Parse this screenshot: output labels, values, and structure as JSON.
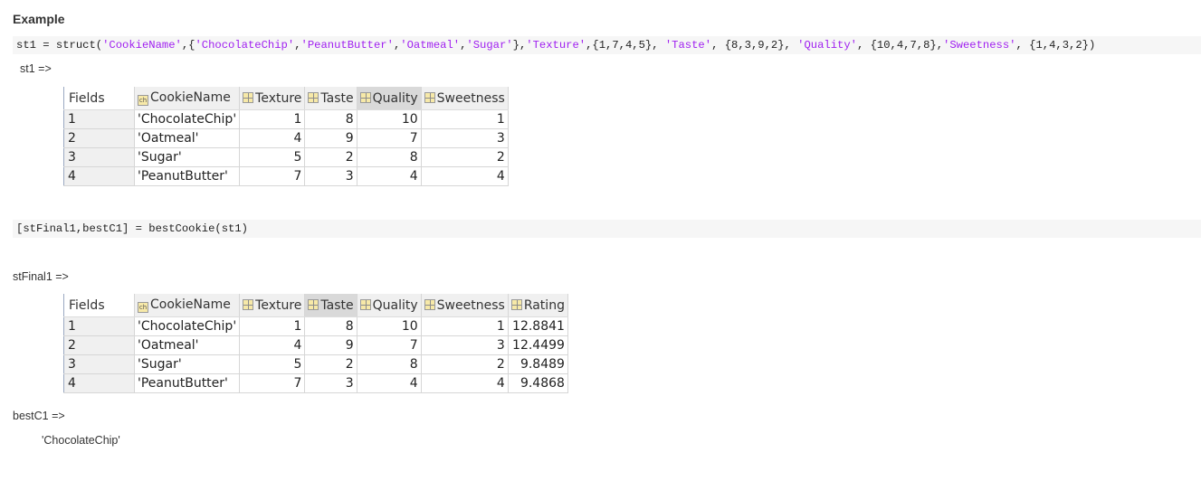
{
  "heading": "Example",
  "code1": {
    "parts": [
      {
        "t": "st1 = struct("
      },
      {
        "t": "'CookieName'",
        "s": 1
      },
      {
        "t": ",{"
      },
      {
        "t": "'ChocolateChip'",
        "s": 1
      },
      {
        "t": ","
      },
      {
        "t": "'PeanutButter'",
        "s": 1
      },
      {
        "t": ","
      },
      {
        "t": "'Oatmeal'",
        "s": 1
      },
      {
        "t": ","
      },
      {
        "t": "'Sugar'",
        "s": 1
      },
      {
        "t": "},"
      },
      {
        "t": "'Texture'",
        "s": 1
      },
      {
        "t": ",{1,7,4,5}, "
      },
      {
        "t": "'Taste'",
        "s": 1
      },
      {
        "t": ", {8,3,9,2}, "
      },
      {
        "t": "'Quality'",
        "s": 1
      },
      {
        "t": ", {10,4,7,8},"
      },
      {
        "t": "'Sweetness'",
        "s": 1
      },
      {
        "t": ", {1,4,3,2})"
      }
    ]
  },
  "label_st1": "st1 =>",
  "table1": {
    "headers": [
      "Fields",
      "CookieName",
      "Texture",
      "Taste",
      "Quality",
      "Sweetness"
    ],
    "selected_header": "Quality",
    "rows": [
      [
        "1",
        "'ChocolateChip'",
        "1",
        "8",
        "10",
        "1"
      ],
      [
        "2",
        "'Oatmeal'",
        "4",
        "9",
        "7",
        "3"
      ],
      [
        "3",
        "'Sugar'",
        "5",
        "2",
        "8",
        "2"
      ],
      [
        "4",
        "'PeanutButter'",
        "7",
        "3",
        "4",
        "4"
      ]
    ]
  },
  "code2": "[stFinal1,bestC1] = bestCookie(st1)",
  "label_stFinal1": "stFinal1 =>",
  "table2": {
    "headers": [
      "Fields",
      "CookieName",
      "Texture",
      "Taste",
      "Quality",
      "Sweetness",
      "Rating"
    ],
    "selected_header": "Taste",
    "rows": [
      [
        "1",
        "'ChocolateChip'",
        "1",
        "8",
        "10",
        "1",
        "12.8841"
      ],
      [
        "2",
        "'Oatmeal'",
        "4",
        "9",
        "7",
        "3",
        "12.4499"
      ],
      [
        "3",
        "'Sugar'",
        "5",
        "2",
        "8",
        "2",
        "9.8489"
      ],
      [
        "4",
        "'PeanutButter'",
        "7",
        "3",
        "4",
        "4",
        "9.4868"
      ]
    ]
  },
  "label_bestC1": "bestC1 =>",
  "bestC1_value": "'ChocolateChip'",
  "colors": {
    "string": "#a020f0",
    "code_bg": "#f6f6f6",
    "header_bg": "#f0f0f0"
  }
}
